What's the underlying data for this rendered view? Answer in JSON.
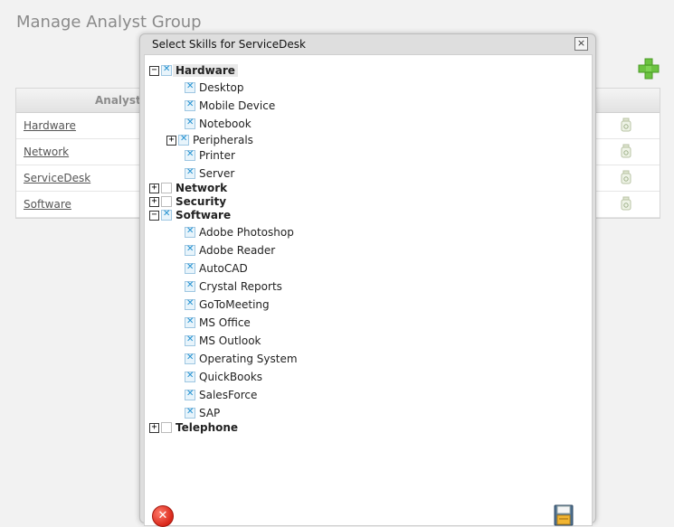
{
  "page": {
    "title": "Manage Analyst Group",
    "add_icon": "plus-icon",
    "grid": {
      "column_header": "Analyst",
      "rows": [
        {
          "name": "Hardware"
        },
        {
          "name": "Network"
        },
        {
          "name": "ServiceDesk"
        },
        {
          "name": "Software"
        }
      ],
      "delete_icon": "trash-icon"
    }
  },
  "modal": {
    "title": "Select Skills for ServiceDesk",
    "close_glyph": "×",
    "cancel_glyph": "✕",
    "save_icon": "floppy-disk-icon",
    "tree": [
      {
        "label": "Hardware",
        "expanded": true,
        "checked": true,
        "children": [
          {
            "label": "Desktop",
            "checked": true
          },
          {
            "label": "Mobile Device",
            "checked": true
          },
          {
            "label": "Notebook",
            "checked": true
          },
          {
            "label": "Peripherals",
            "checked": true,
            "expandable": true,
            "expanded": false
          },
          {
            "label": "Printer",
            "checked": true
          },
          {
            "label": "Server",
            "checked": true
          }
        ]
      },
      {
        "label": "Network",
        "expanded": false,
        "checked": false
      },
      {
        "label": "Security",
        "expanded": false,
        "checked": false
      },
      {
        "label": "Software",
        "expanded": true,
        "checked": true,
        "children": [
          {
            "label": "Adobe Photoshop",
            "checked": true
          },
          {
            "label": "Adobe Reader",
            "checked": true
          },
          {
            "label": "AutoCAD",
            "checked": true
          },
          {
            "label": "Crystal Reports",
            "checked": true
          },
          {
            "label": "GoToMeeting",
            "checked": true
          },
          {
            "label": "MS Office",
            "checked": true
          },
          {
            "label": "MS Outlook",
            "checked": true
          },
          {
            "label": "Operating System",
            "checked": true
          },
          {
            "label": "QuickBooks",
            "checked": true
          },
          {
            "label": "SalesForce",
            "checked": true
          },
          {
            "label": "SAP",
            "checked": true
          }
        ]
      },
      {
        "label": "Telephone",
        "expanded": false,
        "checked": false
      }
    ]
  },
  "colors": {
    "check_accent": "#1e8fd0",
    "add_green": "#5cb531",
    "cancel_red": "#d9271a"
  }
}
